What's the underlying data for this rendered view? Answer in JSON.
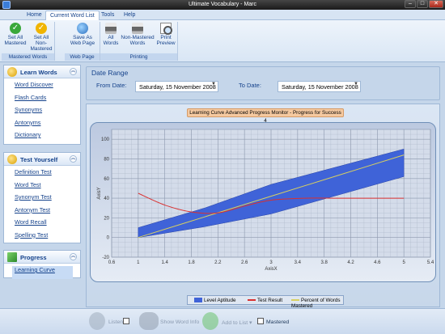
{
  "window": {
    "title": "Ultimate Vocabulary - Marc"
  },
  "tabs": [
    "Home",
    "Current Word List",
    "Tools",
    "Help"
  ],
  "ribbon": {
    "groups": [
      {
        "label": "Mastered Words",
        "buttons": [
          "Set All\nMastered",
          "Set All\nNon-Mastered"
        ]
      },
      {
        "label": "Web Page",
        "buttons": [
          "Save As\nWeb Page"
        ]
      },
      {
        "label": "Printing",
        "buttons": [
          "All\nWords",
          "Non-Mastered\nWords",
          "Print\nPreview"
        ]
      }
    ]
  },
  "sidebar": {
    "learn": {
      "title": "Learn Words",
      "items": [
        "Word Discover",
        "Flash Cards",
        "Synonyms",
        "Antonyms",
        "Dictionary"
      ]
    },
    "test": {
      "title": "Test Yourself",
      "items": [
        "Definition Test",
        "Word Test",
        "Synonym Test",
        "Antonym Test",
        "Word Recall",
        "Spelling Test"
      ]
    },
    "progress": {
      "title": "Progress",
      "items": [
        "Learning Curve"
      ]
    }
  },
  "daterange": {
    "title": "Date Range",
    "from_label": "From Date:",
    "from_value": "Saturday, 15 November 2008",
    "to_label": "To Date:",
    "to_value": "Saturday, 15 November 2008"
  },
  "bottombar": {
    "listen": "Listen",
    "show_word_info": "Show Word Info",
    "add_to_list": "Add to List",
    "mastered": "Mastered"
  },
  "chart_data": {
    "type": "area",
    "title": "Learning Curve Advanced Progress Monitor - Progress for Success 4",
    "xlabel": "AxisX",
    "ylabel": "AxisY",
    "xlim": [
      0.6,
      5.4
    ],
    "ylim": [
      -20,
      110
    ],
    "x_ticks": [
      "0.6",
      "1",
      "1.4",
      "1.8",
      "2.2",
      "2.6",
      "3",
      "3.4",
      "3.8",
      "4.2",
      "4.6",
      "5",
      "5.4"
    ],
    "y_ticks": [
      "-20",
      "0",
      "20",
      "40",
      "60",
      "80",
      "100"
    ],
    "colors": {
      "area": "#3f63d8",
      "test": "#d93030",
      "mastered": "#d8d060"
    },
    "series": [
      {
        "name": "Level Aptitude",
        "kind": "band",
        "x": [
          1,
          2,
          3,
          4,
          5
        ],
        "low": [
          0,
          11,
          24,
          43,
          62
        ],
        "high": [
          10,
          30,
          54,
          72,
          90
        ]
      },
      {
        "name": "Test Result",
        "kind": "line",
        "x": [
          1,
          1.4,
          1.8,
          2.2,
          2.6,
          3,
          3.5,
          4,
          4.5,
          5
        ],
        "values": [
          45,
          33,
          26,
          25,
          32,
          38,
          40,
          40,
          40,
          40
        ]
      },
      {
        "name": "Percent of Words Mastered",
        "kind": "line",
        "x": [
          1,
          2,
          3,
          4,
          5
        ],
        "values": [
          0,
          21,
          42,
          63,
          84
        ]
      }
    ]
  }
}
